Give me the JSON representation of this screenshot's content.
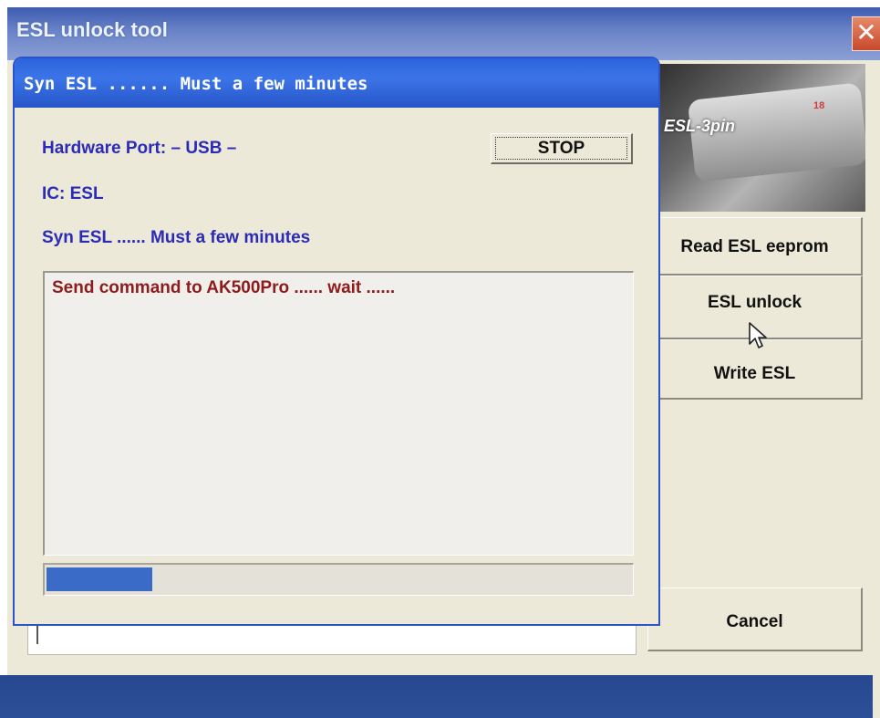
{
  "window": {
    "title": "ESL unlock tool",
    "close_label": "✕"
  },
  "photo": {
    "caption": "ESL-3pin",
    "mark": "18"
  },
  "buttons": {
    "read_eeprom": "Read ESL eeprom",
    "esl_unlock": "ESL unlock",
    "write_esl": "Write ESL",
    "cancel": "Cancel"
  },
  "dialog": {
    "title": "Syn ESL ...... Must a few minutes",
    "hardware_port": "Hardware Port: – USB –",
    "ic": "IC: ESL",
    "status": "Syn ESL ...... Must a few minutes",
    "stop_label": "STOP",
    "log": [
      "Send command to AK500Pro ...... wait ......"
    ],
    "progress": 0.18
  },
  "icons": {
    "close": "close-icon",
    "cursor": "mouse-pointer-icon"
  },
  "colors": {
    "dialog_title_bg": "#2a63dc",
    "info_text": "#2b2bb8",
    "log_text": "#8f1c1c",
    "progress_fill": "#3a6bc6"
  }
}
